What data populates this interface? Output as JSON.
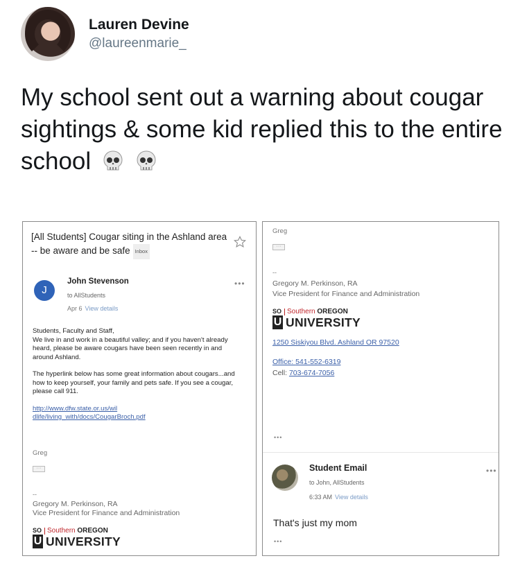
{
  "tweet": {
    "author_name": "Lauren Devine",
    "author_handle": "@laureenmarie_",
    "text": "My school sent out a warning about cougar sightings & some kid replied this to the entire school",
    "emoji_icons": [
      "skull-icon",
      "skull-icon"
    ]
  },
  "email_left": {
    "subject": "[All Students] Cougar siting in the Ashland area -- be aware and be safe",
    "inbox_label": "Inbox",
    "sender_initial": "J",
    "sender_name": "John Stevenson",
    "to_line": "to AllStudents",
    "date": "Apr 6",
    "view_details": "View details",
    "more": "•••",
    "body_paragraph_1": "Students, Faculty and Staff,\nWe live in and work in a beautiful valley; and if you haven't already heard, please be aware cougars have been seen recently in and around Ashland.",
    "body_paragraph_2": "The hyperlink below has some great information about cougars...and how to keep yourself, your family and pets safe.  If you see a cougar, please call 911.",
    "link_line_1": "http://www.dfw.state.or.us/wil",
    "link_line_2": "dlife/living_with/docs/CougarBroch.pdf",
    "greeting": "Greg",
    "collapsed": "···",
    "sig_dash": "--",
    "sig_name": "Gregory M. Perkinson, RA",
    "sig_title": "Vice President for Finance and Administration"
  },
  "email_right": {
    "greeting": "Greg",
    "collapsed": "···",
    "sig_dash": "--",
    "sig_name": "Gregory M. Perkinson, RA",
    "sig_title": "Vice President for Finance and Administration",
    "address": "1250 Siskiyou Blvd. Ashland  OR 97520",
    "office_label": "Office: ",
    "office_number": "541-552-6319",
    "cell_label": "Cell:  ",
    "cell_number": "703-674-7056",
    "trailing_dots": "•••",
    "reply_sender": "Student Email",
    "reply_to": "to John, AllStudents",
    "reply_time": "6:33 AM",
    "reply_view_details": "View details",
    "reply_more": "•••",
    "reply_text": "That's just my mom",
    "reply_trailing": "•••"
  },
  "logo": {
    "so": "SO",
    "u": "U",
    "southern": "Southern",
    "oregon": " OREGON",
    "university": "UNIVERSITY"
  },
  "colors": {
    "link": "#3a5fa8",
    "sender_avatar": "#2f63b8",
    "logo_red": "#c0272d",
    "handle_gray": "#657786"
  }
}
